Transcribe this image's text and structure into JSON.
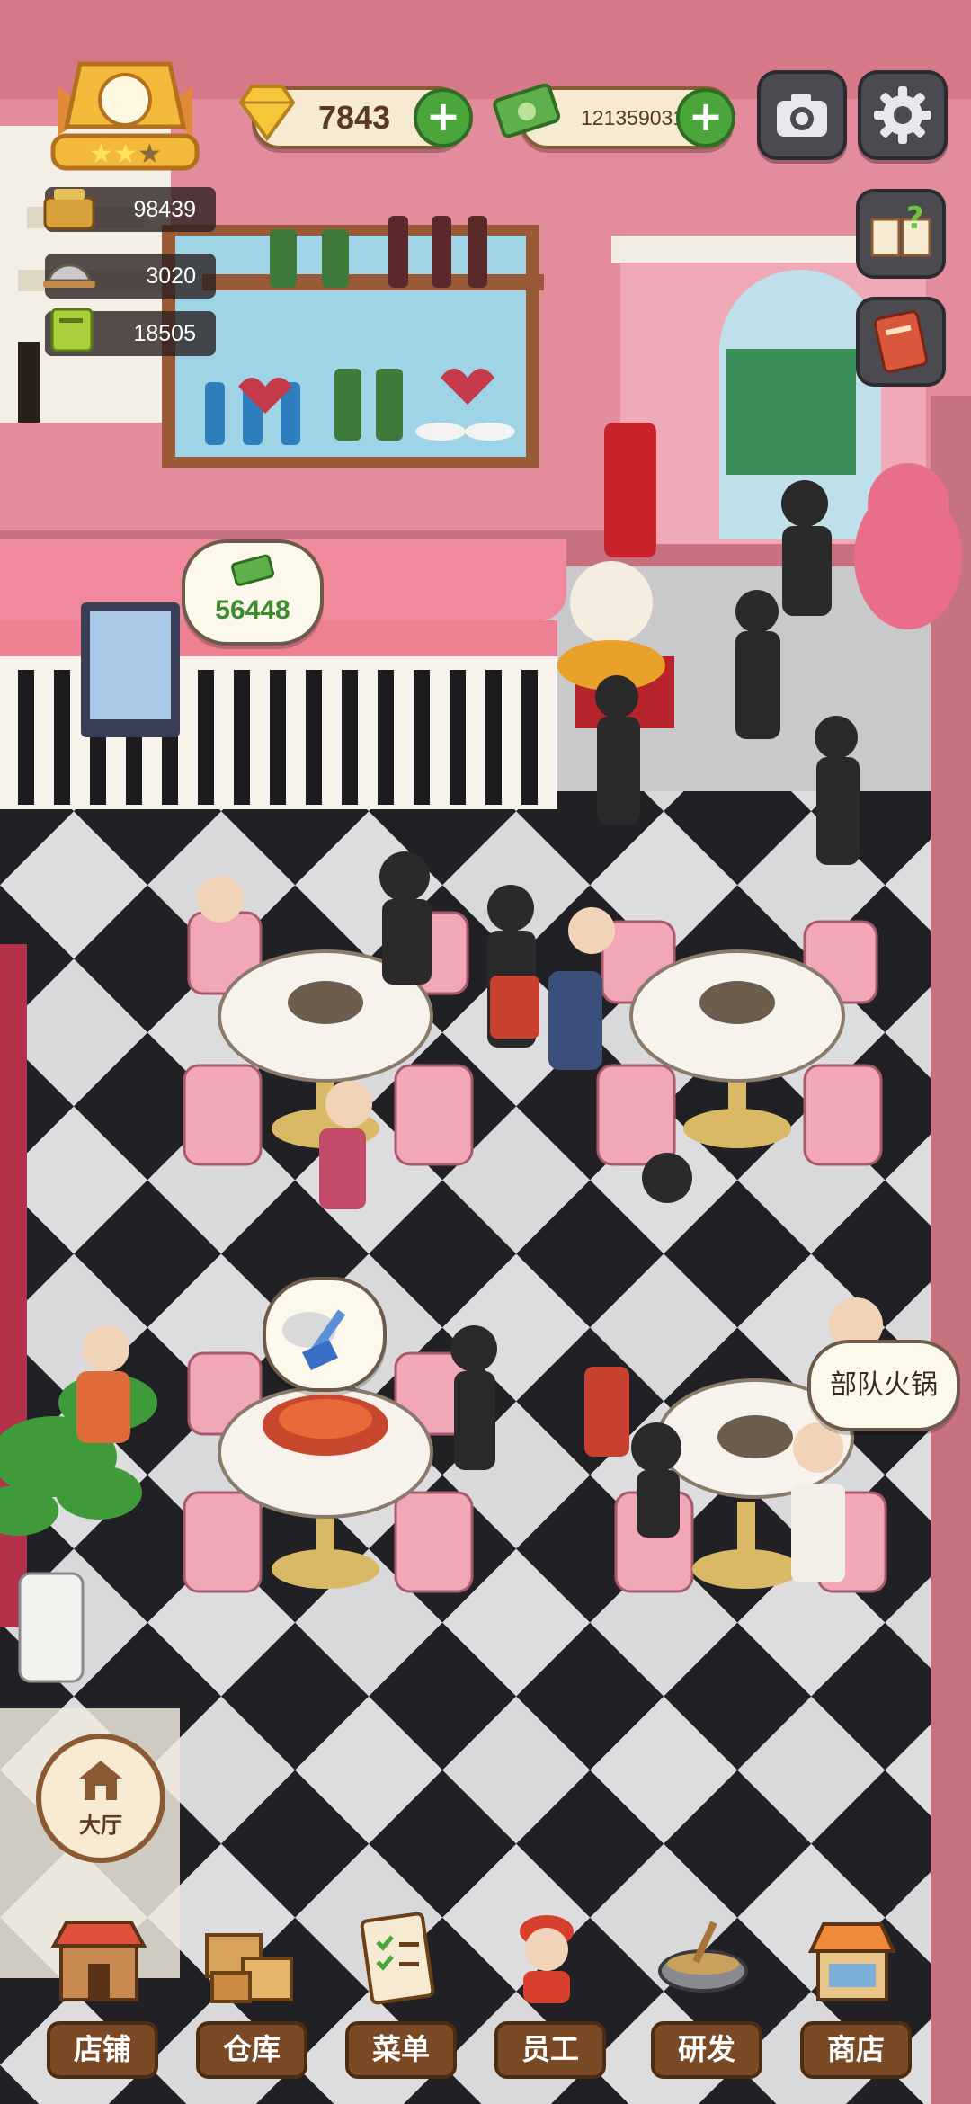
{
  "hud": {
    "gems": "7843",
    "cash": "121359031",
    "resources": [
      "98439",
      "3020",
      "18505"
    ]
  },
  "bubbles": {
    "counter_cash": "56448",
    "order_dish": "部队火锅"
  },
  "nav": {
    "hall": "大厅",
    "items": [
      "店铺",
      "仓库",
      "菜单",
      "员工",
      "研发",
      "商店"
    ]
  },
  "colors": {
    "wall": "#e58a9a",
    "counter": "#ef7f94",
    "floor_dark": "#2a2a2e",
    "floor_light": "#e9e9ea",
    "accent_green": "#4aa63a"
  }
}
